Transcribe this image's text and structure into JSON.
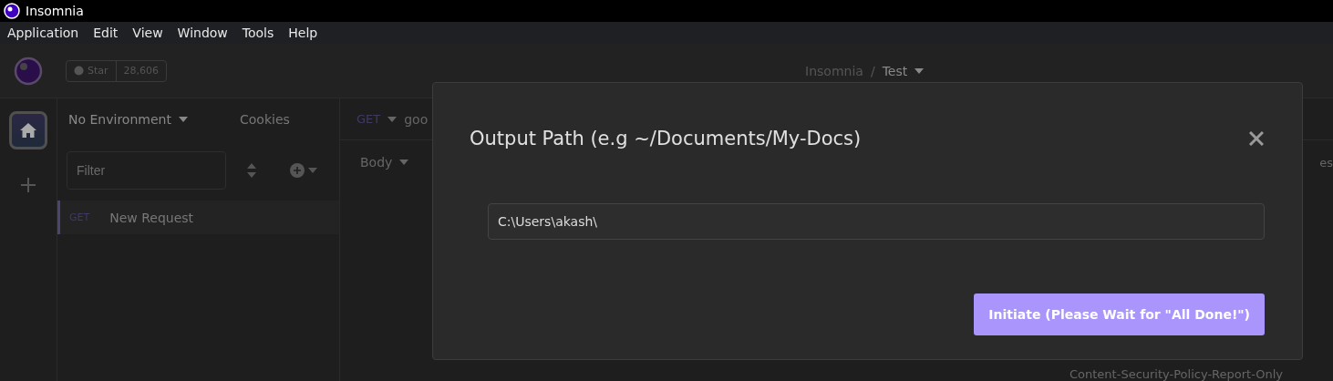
{
  "window": {
    "title": "Insomnia"
  },
  "menu": [
    "Application",
    "Edit",
    "View",
    "Window",
    "Tools",
    "Help"
  ],
  "header": {
    "star_label": "Star",
    "star_count": "28,606",
    "breadcrumb": [
      {
        "label": "Insomnia"
      },
      {
        "label": "Test"
      }
    ],
    "separator": "/"
  },
  "rail": [
    {
      "kind": "home",
      "selected": true
    },
    {
      "kind": "add",
      "selected": false
    }
  ],
  "sidebar": {
    "environment": "No Environment",
    "cookies": "Cookies",
    "filter": {
      "placeholder": "Filter"
    },
    "requests": [
      {
        "method": "GET",
        "name": "New Request",
        "selected": true
      }
    ]
  },
  "request_pane": {
    "method": "GET",
    "url": "goo",
    "body_tab": "Body",
    "right_tab": "es",
    "header_row": "Content-Security-Policy-Report-Only"
  },
  "dialog": {
    "title": "Output Path (e.g ~/Documents/My-Docs)",
    "path": {
      "value": "C:\\Users\\akash\\"
    },
    "button": "Initiate (Please Wait for \"All Done!\")"
  }
}
